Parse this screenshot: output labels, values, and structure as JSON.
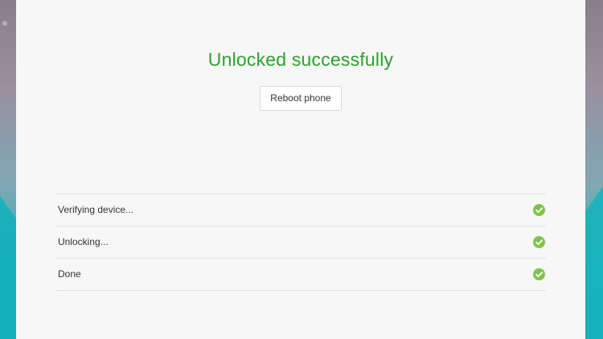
{
  "result": {
    "title": "Unlocked successfully",
    "reboot_label": "Reboot phone"
  },
  "steps": [
    {
      "label": "Verifying device...",
      "icon": "check-circle-icon",
      "status": "complete"
    },
    {
      "label": "Unlocking...",
      "icon": "check-circle-icon",
      "status": "complete"
    },
    {
      "label": "Done",
      "icon": "check-circle-icon",
      "status": "complete"
    }
  ],
  "colors": {
    "success_text": "#2ea02e",
    "check_fill": "#7dc44a",
    "window_bg": "#f7f7f7",
    "divider": "#e0e0e0"
  }
}
